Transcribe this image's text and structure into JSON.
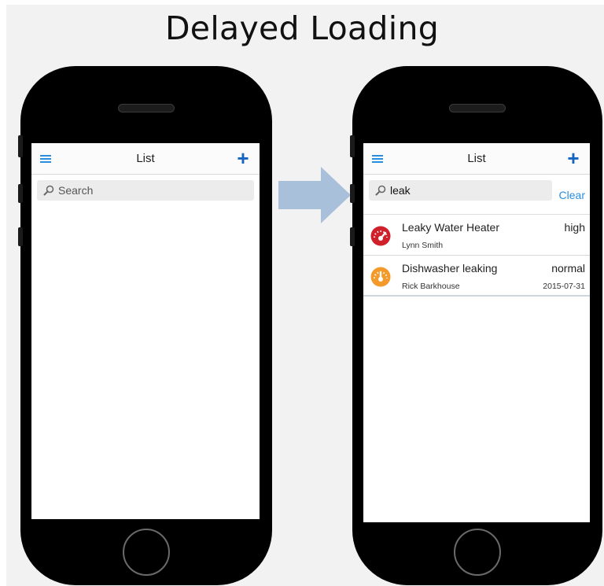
{
  "slide": {
    "title": "Delayed Loading"
  },
  "left_phone": {
    "header": {
      "title": "List"
    },
    "search": {
      "placeholder": "Search"
    }
  },
  "right_phone": {
    "header": {
      "title": "List"
    },
    "search": {
      "value": "leak",
      "clear_label": "Clear"
    },
    "items": [
      {
        "title": "Leaky Water Heater",
        "person": "Lynn Smith",
        "priority": "high",
        "date": "",
        "icon": "gauge-high-icon",
        "icon_color": "#d0202a"
      },
      {
        "title": "Dishwasher leaking",
        "person": "Rick Barkhouse",
        "priority": "normal",
        "date": "2015-07-31",
        "icon": "gauge-normal-icon",
        "icon_color": "#f39a2b"
      }
    ]
  },
  "colors": {
    "accent": "#2a8ee0",
    "add_button": "#1565c0",
    "arrow": "#a9c0da",
    "background": "#f2f2f2"
  }
}
